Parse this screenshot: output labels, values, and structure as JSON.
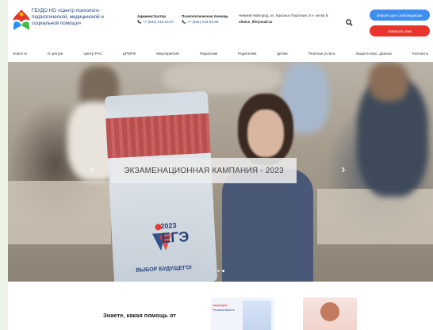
{
  "header": {
    "org_name": "ГБУДО НО «Центр психолого-педагогической, медицинской и социальной помощи»",
    "contacts": [
      {
        "title": "Администратор",
        "phone": "+7 (831) 215-04-67"
      },
      {
        "title": "Психологическая помощь",
        "phone": "+7 (831) 215-04-66"
      }
    ],
    "address": "Нижний Новгород, ул. Красных Партизан, 8 А литер Б",
    "email": "choice_life@mail.ru",
    "btn_accessible": "Версия для слабовидящих",
    "btn_write": "Написать нам"
  },
  "nav": [
    "Новости",
    "О центре",
    "Центр РАС",
    "ЦПМПК",
    "Мероприятия",
    "Педагогам",
    "Родителям",
    "Детям",
    "Платные услуги",
    "Защита перс. данных",
    "Контакты"
  ],
  "hero": {
    "banner_text": "ЭКЗАМЕНАЦИОННАЯ КАМПАНИЯ - 2023",
    "bag_year": "2023",
    "bag_title": "ЕГЭ",
    "bag_slogan": "ВЫБОР БУДУЩЕГО!",
    "slides": 3,
    "active_slide": 3
  },
  "bottom": {
    "text": "Знаете, какая помощь от",
    "card_line1": "госуслуги",
    "card_line2": "Решаем вместе"
  },
  "colors": {
    "brand_blue": "#3d8ef0",
    "brand_red": "#e8352c",
    "org_text": "#1f3d7a"
  }
}
